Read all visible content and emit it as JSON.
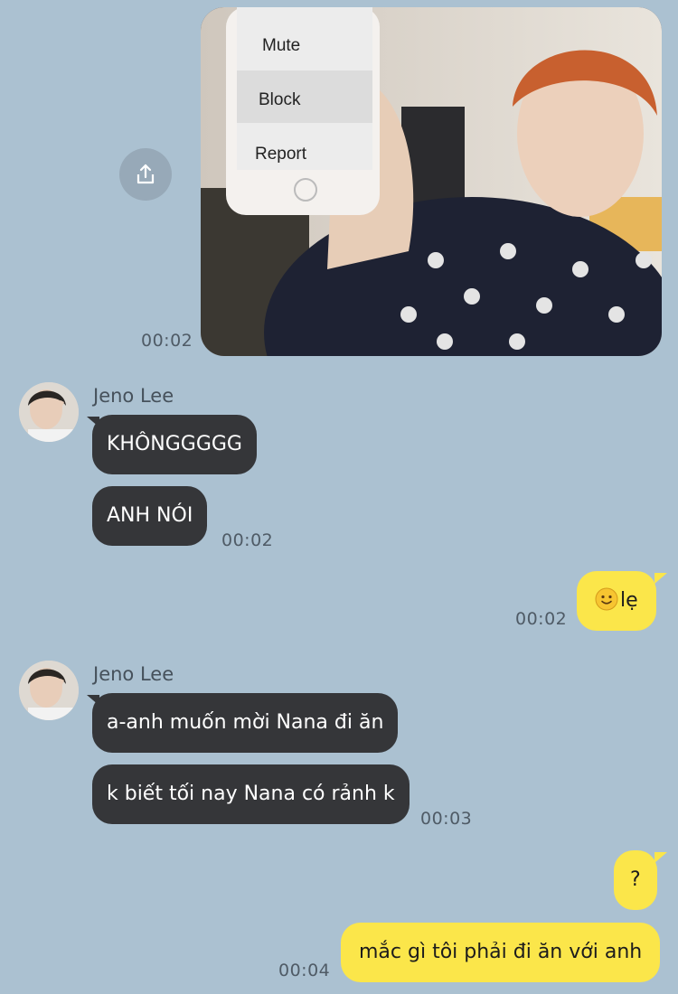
{
  "photo_message": {
    "time": "00:02",
    "phone_menu": [
      "Mute",
      "Block",
      "Report"
    ]
  },
  "groups": [
    {
      "sender": "Jeno Lee",
      "messages": [
        "KHÔNGGGGG",
        "ANH NÓI"
      ],
      "time": "00:02"
    },
    {
      "sender": "Jeno Lee",
      "messages": [
        "a-anh muốn mời Nana đi ăn",
        "k biết tối nay Nana có rảnh k"
      ],
      "time": "00:03"
    }
  ],
  "outgoing": [
    {
      "text": "lẹ",
      "time": "00:02",
      "emoji": "slightly-smiling-face-icon"
    },
    {
      "text": "?",
      "time": ""
    },
    {
      "text": "mắc gì tôi phải đi ăn với anh",
      "time": "00:04"
    }
  ],
  "colors": {
    "background": "#abc1d1",
    "incoming_bubble": "#353639",
    "outgoing_bubble": "#fbe64a"
  }
}
